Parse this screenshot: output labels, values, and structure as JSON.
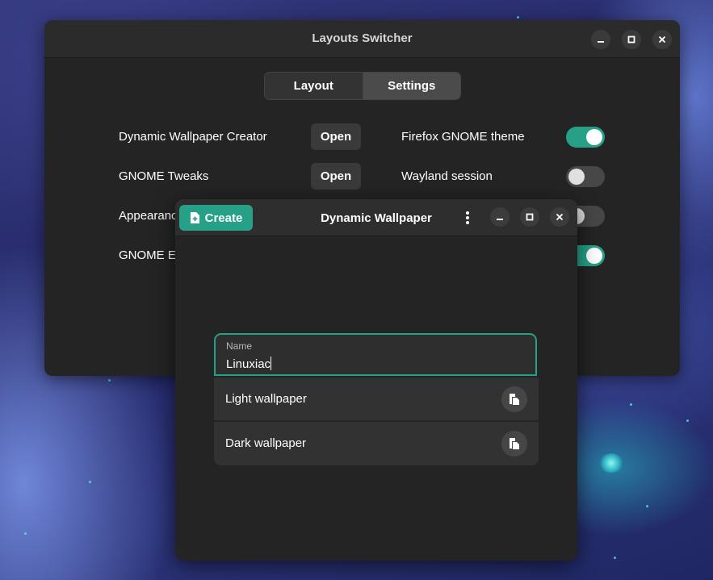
{
  "back_window": {
    "title": "Layouts Switcher",
    "tabs": [
      {
        "label": "Layout",
        "active": false
      },
      {
        "label": "Settings",
        "active": true
      }
    ],
    "left_rows": [
      {
        "label": "Dynamic Wallpaper Creator",
        "button": "Open"
      },
      {
        "label": "GNOME Tweaks",
        "button": "Open"
      },
      {
        "label": "Appearanc"
      },
      {
        "label": "GNOME Ex"
      }
    ],
    "right_rows": [
      {
        "label": "Firefox GNOME theme",
        "on": true
      },
      {
        "label": "Wayland session",
        "on": false
      }
    ]
  },
  "front_window": {
    "title": "Dynamic Wallpaper",
    "create_label": "Create",
    "name_field": {
      "label": "Name",
      "value": "Linuxiac"
    },
    "rows": [
      {
        "label": "Light wallpaper"
      },
      {
        "label": "Dark wallpaper"
      }
    ]
  },
  "colors": {
    "accent": "#26a187",
    "window_bg": "#242424",
    "header_bg": "#2b2b2b"
  }
}
